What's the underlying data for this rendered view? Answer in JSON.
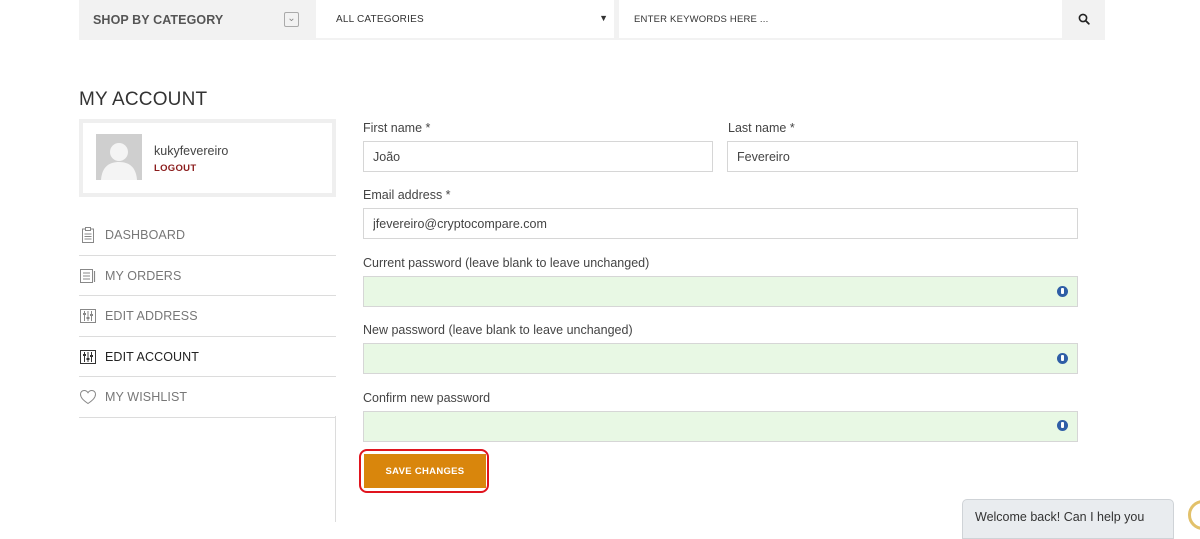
{
  "header": {
    "shop_by_category": "SHOP BY CATEGORY",
    "category_toggle_icon": "chevron-down-icon",
    "category_select": "ALL CATEGORIES",
    "search_placeholder": "ENTER KEYWORDS HERE ...",
    "search_icon": "search-icon"
  },
  "page_title": "MY ACCOUNT",
  "profile": {
    "username": "kukyfevereiro",
    "logout_label": "LOGOUT"
  },
  "nav": {
    "items": [
      {
        "label": "DASHBOARD",
        "icon": "clipboard-icon"
      },
      {
        "label": "MY ORDERS",
        "icon": "orders-icon"
      },
      {
        "label": "EDIT ADDRESS",
        "icon": "sliders-icon"
      },
      {
        "label": "EDIT ACCOUNT",
        "icon": "sliders-icon",
        "active": true
      },
      {
        "label": "MY WISHLIST",
        "icon": "heart-icon"
      }
    ]
  },
  "form": {
    "first_name_label": "First name *",
    "first_name_value": "João",
    "last_name_label": "Last name *",
    "last_name_value": "Fevereiro",
    "email_label": "Email address *",
    "email_value": "jfevereiro@cryptocompare.com",
    "current_password_label": "Current password (leave blank to leave unchanged)",
    "new_password_label": "New password (leave blank to leave unchanged)",
    "confirm_password_label": "Confirm new password",
    "save_label": "SAVE CHANGES"
  },
  "chat": {
    "message": "Welcome back! Can I help you"
  },
  "colors": {
    "accent": "#d9860c",
    "logout": "#8b1c1c",
    "highlight": "#e0141e",
    "password_bg": "#e8f8e4"
  }
}
